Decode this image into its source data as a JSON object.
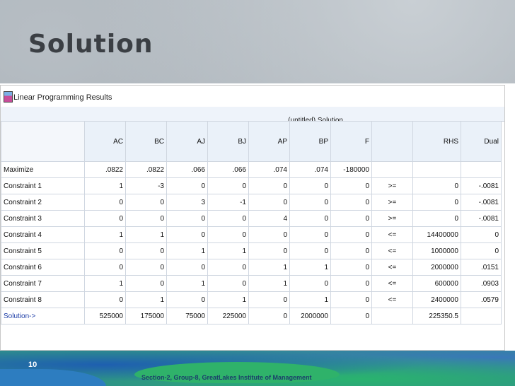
{
  "slide": {
    "title": "Solution",
    "page_number": "10",
    "footer": "Section-2, Group-8, GreatLakes Institute of Management"
  },
  "window": {
    "title": "Linear Programming Results",
    "header": "(untitled) Solution"
  },
  "table": {
    "columns": [
      "",
      "AC",
      "BC",
      "AJ",
      "BJ",
      "AP",
      "BP",
      "F",
      "",
      "RHS",
      "Dual"
    ],
    "rows": [
      [
        "Maximize",
        ".0822",
        ".0822",
        ".066",
        ".066",
        ".074",
        ".074",
        "-180000",
        "",
        "",
        ""
      ],
      [
        "Constraint 1",
        "1",
        "-3",
        "0",
        "0",
        "0",
        "0",
        "0",
        ">=",
        "0",
        "-.0081"
      ],
      [
        "Constraint 2",
        "0",
        "0",
        "3",
        "-1",
        "0",
        "0",
        "0",
        ">=",
        "0",
        "-.0081"
      ],
      [
        "Constraint 3",
        "0",
        "0",
        "0",
        "0",
        "4",
        "0",
        "0",
        ">=",
        "0",
        "-.0081"
      ],
      [
        "Constraint 4",
        "1",
        "1",
        "0",
        "0",
        "0",
        "0",
        "0",
        "<=",
        "14400000",
        "0"
      ],
      [
        "Constraint 5",
        "0",
        "0",
        "1",
        "1",
        "0",
        "0",
        "0",
        "<=",
        "1000000",
        "0"
      ],
      [
        "Constraint 6",
        "0",
        "0",
        "0",
        "0",
        "1",
        "1",
        "0",
        "<=",
        "2000000",
        ".0151"
      ],
      [
        "Constraint 7",
        "1",
        "0",
        "1",
        "0",
        "1",
        "0",
        "0",
        "<=",
        "600000",
        ".0903"
      ],
      [
        "Constraint 8",
        "0",
        "1",
        "0",
        "1",
        "0",
        "1",
        "0",
        "<=",
        "2400000",
        ".0579"
      ],
      [
        "Solution->",
        "525000",
        "175000",
        "75000",
        "225000",
        "0",
        "2000000",
        "0",
        "",
        "225350.5",
        ""
      ]
    ]
  }
}
